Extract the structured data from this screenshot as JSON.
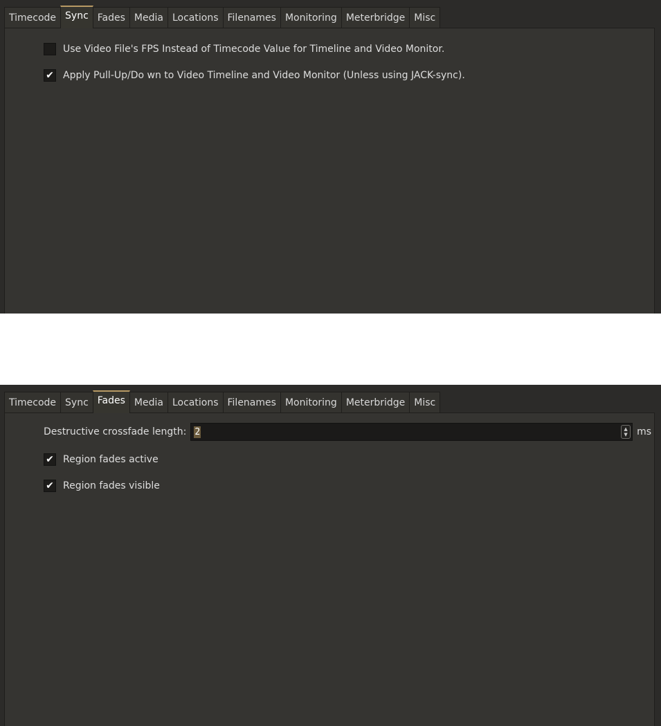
{
  "top": {
    "tabs": [
      {
        "label": "Timecode"
      },
      {
        "label": "Sync",
        "active": true
      },
      {
        "label": "Fades"
      },
      {
        "label": "Media"
      },
      {
        "label": "Locations"
      },
      {
        "label": "Filenames"
      },
      {
        "label": "Monitoring"
      },
      {
        "label": "Meterbridge"
      },
      {
        "label": "Misc"
      }
    ],
    "options": [
      {
        "label": "Use Video File's FPS Instead of Timecode Value for Timeline and Video Monitor.",
        "checked": false,
        "mark": ""
      },
      {
        "label": "Apply Pull-Up/Do wn to Video Timeline and Video Monitor (Unless using JACK-sync).",
        "checked": true,
        "mark": "✔"
      }
    ]
  },
  "bottom": {
    "tabs": [
      {
        "label": "Timecode"
      },
      {
        "label": "Sync"
      },
      {
        "label": "Fades",
        "active": true
      },
      {
        "label": "Media"
      },
      {
        "label": "Locations"
      },
      {
        "label": "Filenames"
      },
      {
        "label": "Monitoring"
      },
      {
        "label": "Meterbridge"
      },
      {
        "label": "Misc"
      }
    ],
    "crossfade": {
      "label": "Destructive crossfade length:",
      "value": "2",
      "unit": "ms",
      "up": "▲",
      "down": "▼"
    },
    "options": [
      {
        "label": "Region fades active",
        "checked": true,
        "mark": "✔"
      },
      {
        "label": "Region fades visible",
        "checked": true,
        "mark": "✔"
      }
    ]
  }
}
